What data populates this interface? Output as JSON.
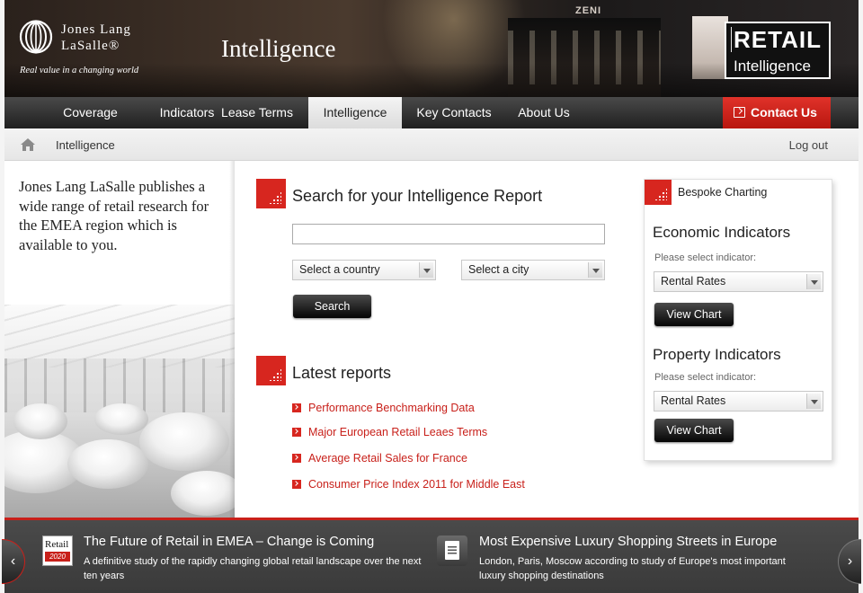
{
  "header": {
    "logo_line1": "Jones Lang",
    "logo_line2": "LaSalle®",
    "tagline": "Real value in a changing world",
    "title": "Intelligence",
    "product_logo_line1": "RETAIL",
    "product_logo_line2": "Intelligence",
    "store_sign": "ZENI"
  },
  "nav": {
    "items": [
      {
        "label": "Coverage"
      },
      {
        "label": "Indicators"
      },
      {
        "label": "Lease Terms"
      },
      {
        "label": "Intelligence",
        "active": true
      },
      {
        "label": "Key Contacts"
      },
      {
        "label": "About Us"
      }
    ],
    "contact_label": "Contact Us"
  },
  "breadcrumb": {
    "current": "Intelligence",
    "logout": "Log out"
  },
  "intro": "Jones Lang LaSalle publishes a wide range of retail research for the EMEA region which is available to you.",
  "search": {
    "heading": "Search for your Intelligence Report",
    "input_value": "",
    "country_select": "Select a country",
    "city_select": "Select a city",
    "button": "Search"
  },
  "latest": {
    "heading": "Latest reports",
    "reports": [
      "Performance  Benchmarking  Data",
      "Major European Retail Leaes Terms",
      "Average Retail Sales for France",
      "Consumer Price Index 2011 for Middle East"
    ]
  },
  "bespoke": {
    "title": "Bespoke Charting",
    "economic": {
      "heading": "Economic Indicators",
      "prompt": "Please select indicator:",
      "selected": "Rental Rates",
      "button": "View Chart"
    },
    "property": {
      "heading": "Property Indicators",
      "prompt": "Please select indicator:",
      "selected": "Rental Rates",
      "button": "View Chart"
    }
  },
  "news": [
    {
      "icon_top": "Retail",
      "icon_bottom": "2020",
      "title": "The Future of Retail in EMEA – Change is Coming",
      "desc": "A definitive study of the rapidly changing global retail landscape over the next ten years"
    },
    {
      "title": "Most Expensive Luxury Shopping Streets in Europe",
      "desc": "London, Paris, Moscow according to study of Europe's most important luxury shopping destinations"
    }
  ],
  "carousel": {
    "prev": "‹",
    "next": "›"
  },
  "colors": {
    "accent_red": "#d7261f",
    "nav_dark": "#1f1f1f",
    "link_red": "#c8201a"
  }
}
